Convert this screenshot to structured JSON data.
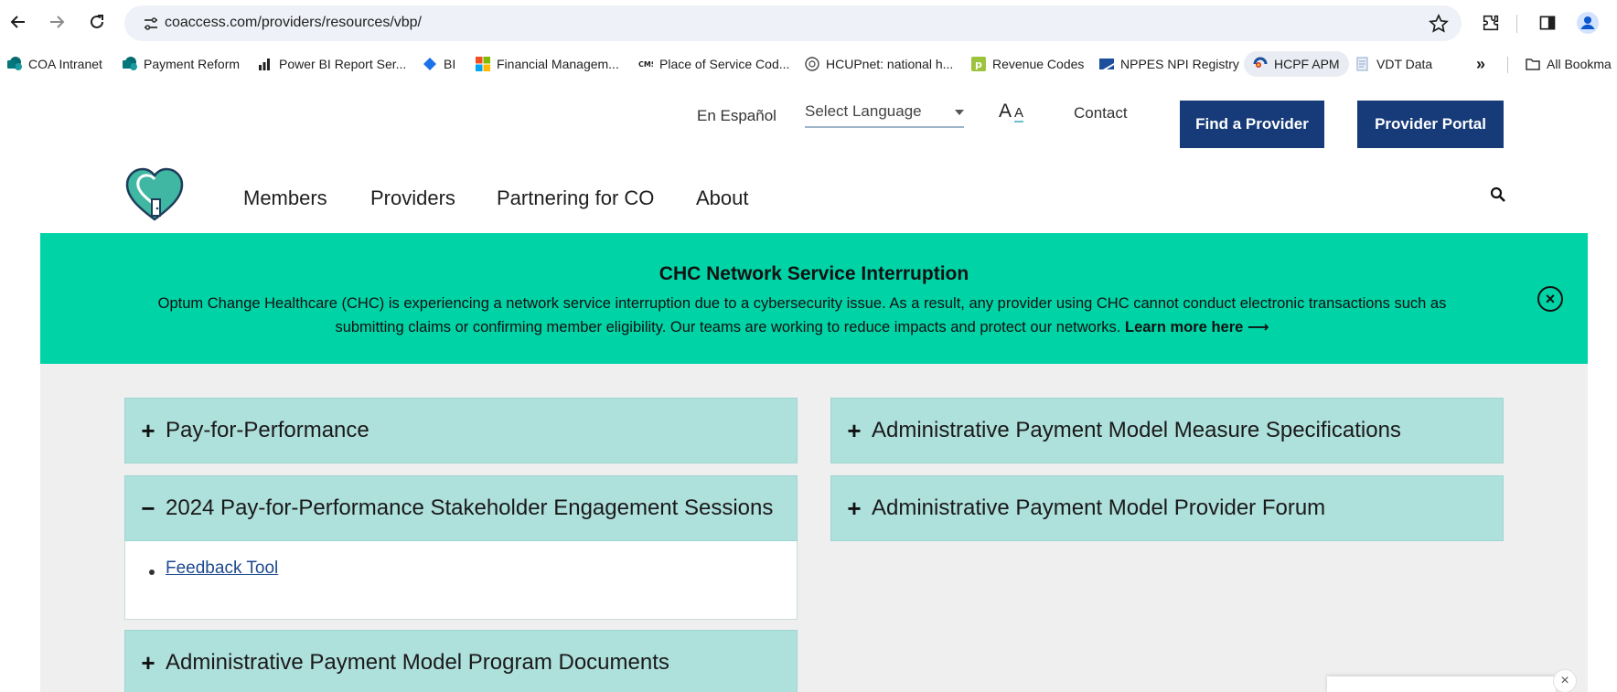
{
  "browser": {
    "url": "coaccess.com/providers/resources/vbp/",
    "bookmarks": [
      {
        "label": "COA Intranet",
        "icon": "sharepoint-icon"
      },
      {
        "label": "Payment Reform",
        "icon": "sharepoint-icon"
      },
      {
        "label": "Power BI Report Ser...",
        "icon": "power-bi-icon"
      },
      {
        "label": "BI",
        "icon": "diamond-icon"
      },
      {
        "label": "Financial Managem...",
        "icon": "microsoft-icon"
      },
      {
        "label": "Place of Service Cod...",
        "icon": "cms-icon"
      },
      {
        "label": "HCUPnet: national h...",
        "icon": "hcup-icon"
      },
      {
        "label": "Revenue Codes",
        "icon": "revenue-icon"
      },
      {
        "label": "NPPES NPI Registry",
        "icon": "hhs-icon"
      },
      {
        "label": "HCPF APM",
        "icon": "colorado-icon"
      },
      {
        "label": "VDT Data",
        "icon": "document-icon"
      }
    ],
    "more_bookmarks": "»",
    "all_bookmarks": "All Bookma"
  },
  "header": {
    "espanol": "En Español",
    "language_placeholder": "Select Language",
    "text_size_large": "A",
    "text_size_small": "A",
    "contact": "Contact",
    "find_provider": "Find a Provider",
    "provider_portal": "Provider Portal"
  },
  "nav": {
    "items": [
      "Members",
      "Providers",
      "Partnering for CO",
      "About"
    ]
  },
  "alert": {
    "title": "CHC Network Service Interruption",
    "body": "Optum Change Healthcare (CHC) is experiencing a network service interruption due to a cybersecurity issue. As a result, any provider using CHC cannot conduct electronic transactions such as submitting claims or confirming member eligibility. Our teams are working to reduce impacts and protect our networks.",
    "link": "Learn more here ⟶",
    "close": "×"
  },
  "accordions": {
    "left": [
      {
        "sign": "+",
        "title": "Pay-for-Performance"
      },
      {
        "sign": "−",
        "title": "2024 Pay-for-Performance Stakeholder Engagement Sessions",
        "link": "Feedback Tool"
      },
      {
        "sign": "+",
        "title": "Administrative Payment Model Program Documents"
      }
    ],
    "right": [
      {
        "sign": "+",
        "title": "Administrative Payment Model Measure Specifications"
      },
      {
        "sign": "+",
        "title": "Administrative Payment Model Provider Forum"
      }
    ]
  },
  "chat": {
    "close": "×"
  },
  "colors": {
    "brand_navy": "#163b78",
    "alert_green": "#00d3a6",
    "accordion_teal": "#aee0dc",
    "link_blue": "#1d4a8f"
  }
}
